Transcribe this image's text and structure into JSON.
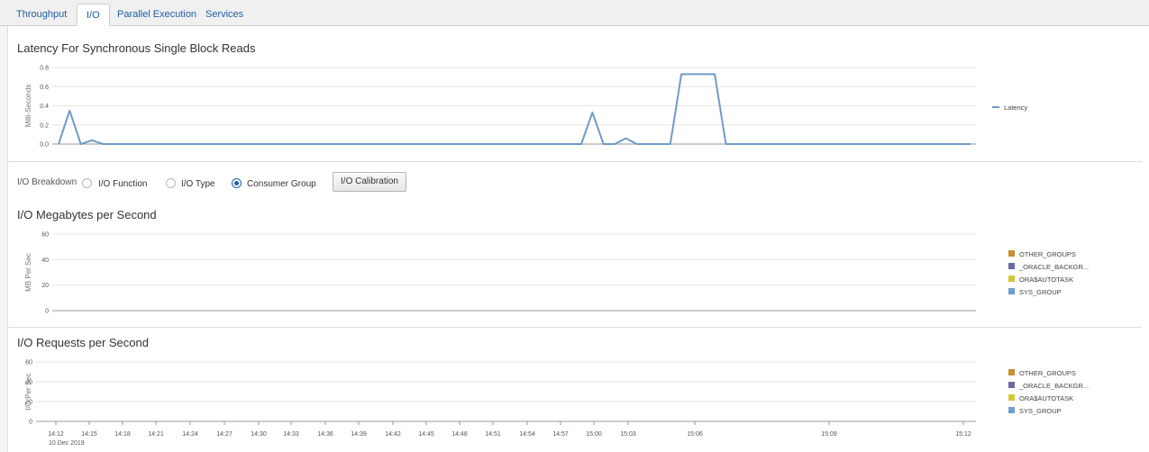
{
  "tabs": [
    {
      "label": "Throughput",
      "active": false
    },
    {
      "label": "I/O",
      "active": true
    },
    {
      "label": "Parallel Execution",
      "active": false
    },
    {
      "label": "Services",
      "active": false
    }
  ],
  "latency_section": {
    "title": "Latency For Synchronous Single Block Reads"
  },
  "io_breakdown": {
    "label": "I/O Breakdown",
    "options": [
      {
        "label": "I/O Function",
        "selected": false
      },
      {
        "label": "I/O Type",
        "selected": false
      },
      {
        "label": "Consumer Group",
        "selected": true
      }
    ],
    "calibration_button": "I/O Calibration"
  },
  "mbps_section": {
    "title": "I/O Megabytes per Second"
  },
  "rps_section": {
    "title": "I/O Requests per Second"
  },
  "date_label": "10 Dec 2019",
  "colors": {
    "line": "#6f9bc8",
    "other_groups": "#c8902f",
    "oracle_backgr": "#6a6aa0",
    "ora_autotask": "#d2c83a",
    "sys_group": "#6c9fcf"
  },
  "chart_data": [
    {
      "type": "line",
      "title": "Latency For Synchronous Single Block Reads",
      "ylabel": "Milli-Seconds",
      "xlabel": "",
      "ylim": [
        0,
        0.8
      ],
      "yticks": [
        "0.0",
        "0.2",
        "0.4",
        "0.6",
        "0.8"
      ],
      "grid": true,
      "legend": "right",
      "x": [
        0,
        1,
        2,
        3,
        4,
        5,
        6,
        7,
        8,
        9,
        10,
        11,
        12,
        13,
        14,
        15,
        16,
        17,
        18,
        19,
        20,
        21,
        22,
        23,
        24,
        25,
        26,
        27,
        28,
        29,
        30,
        31,
        32,
        33,
        34,
        35,
        36,
        37,
        38,
        39,
        40,
        41,
        42,
        43,
        44,
        45,
        46,
        47,
        48,
        49,
        50,
        51,
        52,
        53,
        54,
        55,
        56,
        57,
        58,
        59,
        60,
        61,
        62,
        63,
        64,
        65,
        66,
        67,
        68,
        69,
        70,
        71,
        72,
        73,
        74,
        75,
        76,
        77,
        78,
        79,
        80,
        81,
        82
      ],
      "series": [
        {
          "name": "Latency",
          "values": [
            0.0,
            0.35,
            0.0,
            0.04,
            0.0,
            0.0,
            0.0,
            0.0,
            0.0,
            0.0,
            0.0,
            0.0,
            0.0,
            0.0,
            0.0,
            0.0,
            0.0,
            0.0,
            0.0,
            0.0,
            0.0,
            0.0,
            0.0,
            0.0,
            0.0,
            0.0,
            0.0,
            0.0,
            0.0,
            0.0,
            0.0,
            0.0,
            0.0,
            0.0,
            0.0,
            0.0,
            0.0,
            0.0,
            0.0,
            0.0,
            0.0,
            0.0,
            0.0,
            0.0,
            0.0,
            0.0,
            0.0,
            0.0,
            0.33,
            0.0,
            0.0,
            0.06,
            0.0,
            0.0,
            0.0,
            0.0,
            0.73,
            0.73,
            0.73,
            0.73,
            0.0,
            0.0,
            0.0,
            0.0,
            0.0,
            0.0,
            0.0,
            0.0,
            0.0,
            0.0,
            0.0,
            0.0,
            0.0,
            0.0,
            0.0,
            0.0,
            0.0,
            0.0,
            0.0,
            0.0,
            0.0,
            0.0,
            0.0
          ]
        }
      ]
    },
    {
      "type": "area",
      "title": "I/O Megabytes per Second",
      "ylabel": "MB Per Sec",
      "xlabel": "",
      "ylim": [
        0,
        60
      ],
      "yticks": [
        "0",
        "20",
        "40",
        "60"
      ],
      "grid": true,
      "legend": "right",
      "series": [
        {
          "name": "OTHER_GROUPS",
          "values": []
        },
        {
          "name": "_ORACLE_BACKGR...",
          "values": []
        },
        {
          "name": "ORA$AUTOTASK",
          "values": []
        },
        {
          "name": "SYS_GROUP",
          "values": []
        }
      ]
    },
    {
      "type": "area",
      "title": "I/O Requests per Second",
      "ylabel": "I/O Per Sec",
      "xlabel": "",
      "ylim": [
        0,
        60
      ],
      "yticks": [
        "0",
        "20",
        "40",
        "60"
      ],
      "grid": true,
      "legend": "right",
      "categories": [
        "14:12",
        "14:15",
        "14:18",
        "14:21",
        "14:24",
        "14:27",
        "14:30",
        "14:33",
        "14:36",
        "14:39",
        "14:42",
        "14:45",
        "14:48",
        "14:51",
        "14:54",
        "14:57",
        "15:00",
        "15:03",
        "15:06",
        "15:09",
        "15:12"
      ],
      "series": [
        {
          "name": "OTHER_GROUPS",
          "values": []
        },
        {
          "name": "_ORACLE_BACKGR...",
          "values": []
        },
        {
          "name": "ORA$AUTOTASK",
          "values": []
        },
        {
          "name": "SYS_GROUP",
          "values": []
        }
      ]
    }
  ]
}
